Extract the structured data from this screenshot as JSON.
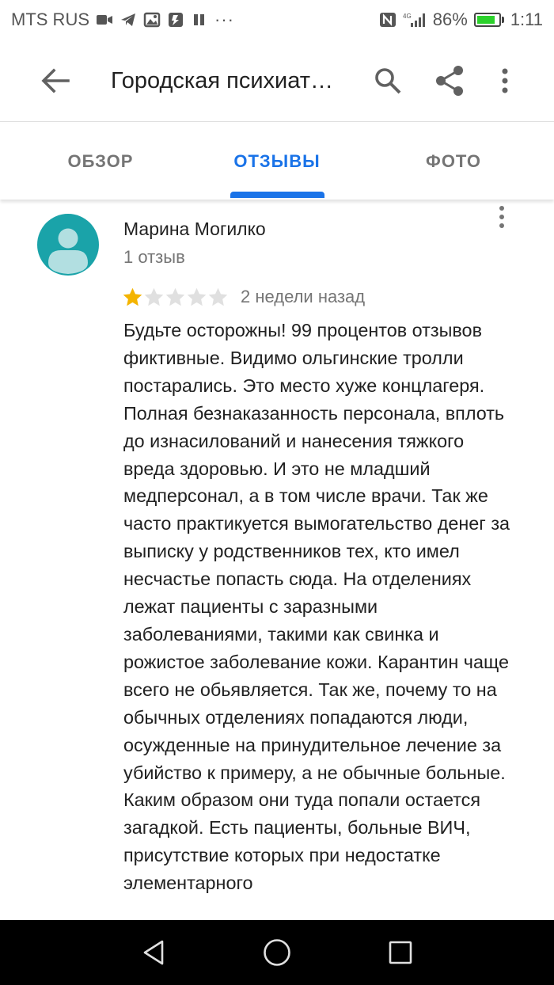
{
  "status_bar": {
    "carrier": "MTS RUS",
    "battery": "86%",
    "battery_level": 0.86,
    "time": "1:11",
    "network": "4G"
  },
  "app_bar": {
    "title": "Городская психиат…"
  },
  "tabs": [
    {
      "label": "ОБЗОР",
      "active": false
    },
    {
      "label": "ОТЗЫВЫ",
      "active": true
    },
    {
      "label": "ФОТО",
      "active": false
    }
  ],
  "review": {
    "author": "Марина Могилко",
    "count": "1 отзыв",
    "rating": 1,
    "rating_max": 5,
    "date": "2 недели назад",
    "text": "Будьте осторожны! 99 процентов отзывов фиктивные. Видимо ольгинские тролли постарались. Это место хуже концлагеря. Полная безнаказанность персонала, вплоть до изнасилований и нанесения тяжкого вреда здоровью. И это не младший медперсонал, а в том числе врачи. Так же часто практикуется вымогательство денег за выписку у родственников тех, кто имел несчастье попасть сюда. На отделениях лежат пациенты с заразными заболеваниями, такими как свинка и рожистое заболевание кожи. Карантин чаще всего не обьявляется. Так же, почему то на обычных отделениях попадаются люди, осужденные на принудительное лечение за убийство к примеру, а не обычные больные. Каким образом они туда попали остается загадкой. Есть пациенты, больные ВИЧ, присутствие которых при недостатке элементарного"
  },
  "colors": {
    "accent": "#1a73e8",
    "star_filled": "#f4b400",
    "star_empty": "#e0e0e0",
    "avatar_bg": "#1aa3a9"
  }
}
